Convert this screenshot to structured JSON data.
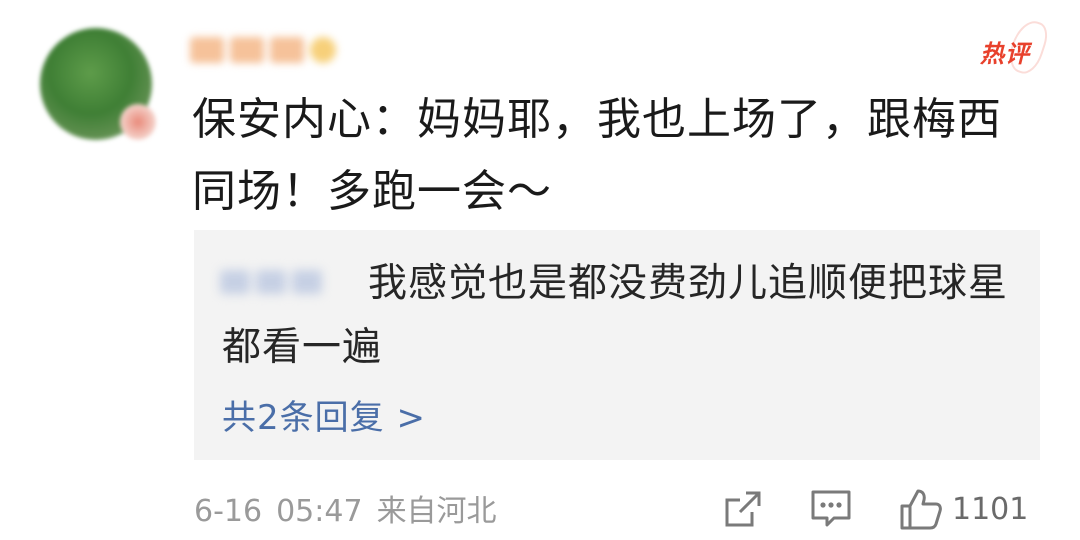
{
  "comment": {
    "avatar": "user-avatar",
    "badge": "热评",
    "text": "保安内心：妈妈耶，我也上场了，跟梅西同场！多跑一会～"
  },
  "reply": {
    "text": "我感觉也是都没费劲儿追顺便把球星都看一遍",
    "more_label": "共2条回复 >"
  },
  "footer": {
    "date": "6-16",
    "time": "05:47",
    "source": "来自河北",
    "like_count": "1101"
  },
  "icons": {
    "share": "share-icon",
    "comment": "comment-icon",
    "like": "thumbs-up-icon"
  },
  "colors": {
    "hot": "#e8412c",
    "link": "#4a6ea8",
    "reply_bg": "#f3f3f3",
    "meta": "#9a9a9a"
  }
}
